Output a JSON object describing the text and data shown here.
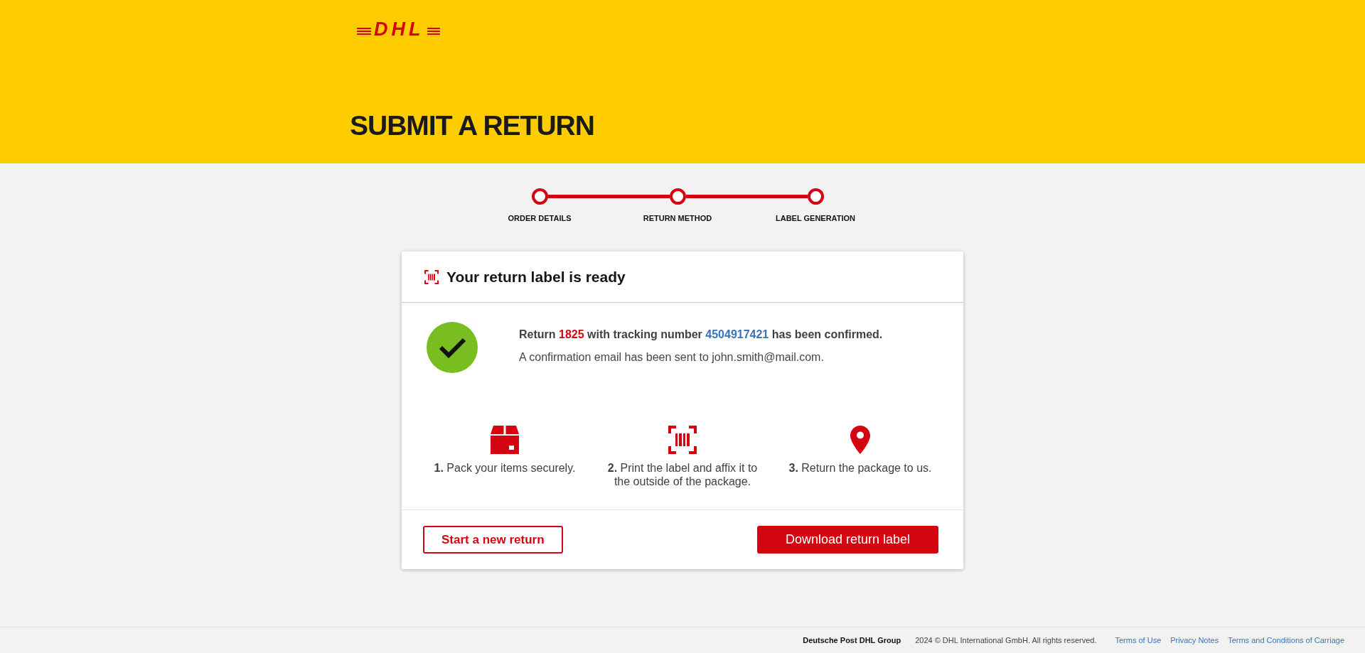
{
  "header": {
    "logo": "DHL",
    "title": "SUBMIT A RETURN"
  },
  "stepper": {
    "steps": [
      {
        "label": "ORDER DETAILS"
      },
      {
        "label": "RETURN METHOD"
      },
      {
        "label": "LABEL GENERATION"
      }
    ]
  },
  "card": {
    "title": "Your return label is ready",
    "confirmation": {
      "parts": [
        {
          "kind": "text",
          "text": "Return "
        },
        {
          "kind": "return_number",
          "text": "1825"
        },
        {
          "kind": "text",
          "text": " with tracking number "
        },
        {
          "kind": "tracking_number",
          "text": "4504917421"
        },
        {
          "kind": "text",
          "text": " has been confirmed."
        }
      ],
      "email_note": "A confirmation email has been sent to john.smith@mail.com."
    },
    "steps": [
      {
        "kind": "pack",
        "text": "**1.** Pack your items securely."
      },
      {
        "kind": "print",
        "text": "**2.** Print the label and affix it to the outside of the package."
      },
      {
        "kind": "return",
        "text": "**3.** Return the package to us."
      }
    ],
    "buttons": [
      {
        "kind": "secondary",
        "label": "Start a new return"
      },
      {
        "kind": "primary",
        "label": "Download return label"
      }
    ]
  },
  "footer": {
    "company": "Deutsche Post DHL Group",
    "copyright": "2024 © DHL International GmbH. All rights reserved.",
    "links": [
      "Terms of Use",
      "Privacy Notes",
      "Terms and Conditions of Carriage"
    ]
  }
}
